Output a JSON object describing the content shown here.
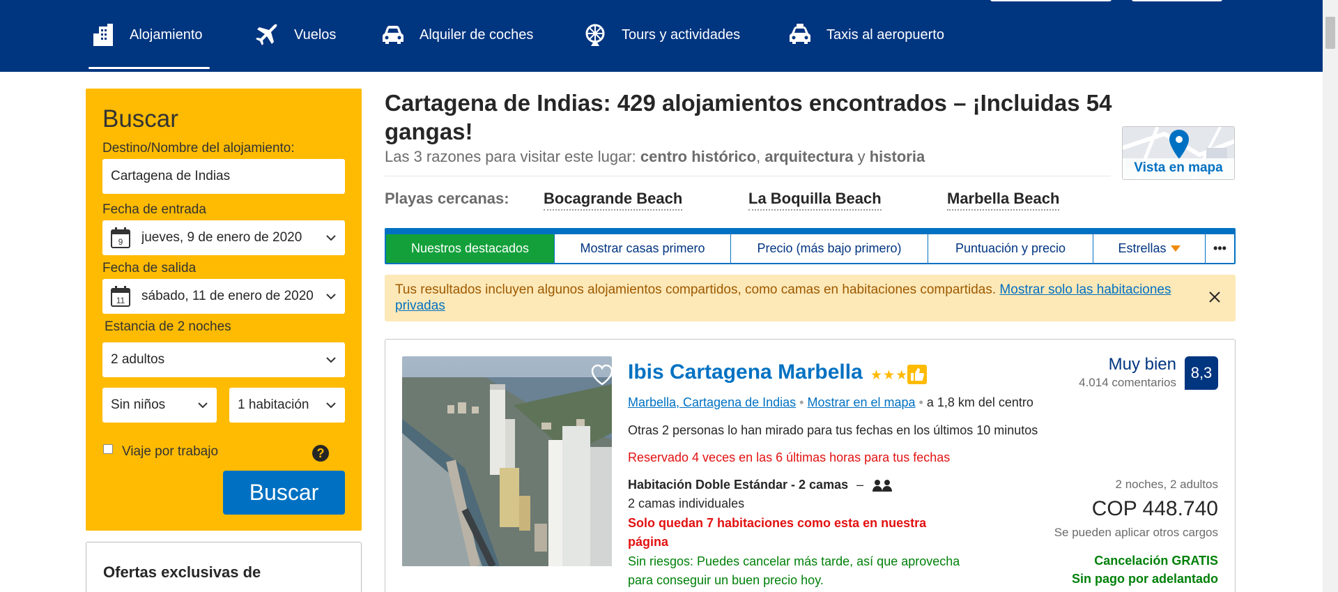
{
  "nav": {
    "items": [
      {
        "label": "Alojamiento",
        "icon": "building-icon",
        "active": true
      },
      {
        "label": "Vuelos",
        "icon": "plane-icon"
      },
      {
        "label": "Alquiler de coches",
        "icon": "car-icon"
      },
      {
        "label": "Tours y actividades",
        "icon": "ferris-wheel-icon"
      },
      {
        "label": "Taxis al aeropuerto",
        "icon": "taxi-icon"
      }
    ]
  },
  "search": {
    "title": "Buscar",
    "destination_label": "Destino/Nombre del alojamiento:",
    "destination_value": "Cartagena de Indias",
    "checkin_label": "Fecha de entrada",
    "checkin_value": "jueves, 9 de enero de 2020",
    "checkin_day": "9",
    "checkout_label": "Fecha de salida",
    "checkout_value": "sábado, 11 de enero de 2020",
    "checkout_day": "11",
    "stay_label": "Estancia de 2 noches",
    "adults_value": "2 adultos",
    "children_value": "Sin niños",
    "rooms_value": "1 habitación",
    "business_label": "Viaje por trabajo",
    "help_glyph": "?",
    "button_label": "Buscar",
    "offers_title": "Ofertas exclusivas de"
  },
  "results": {
    "title": "Cartagena de Indias: 429 alojamientos encontrados – ¡Incluidas 54 gangas!",
    "reasons_prefix": "Las 3 razones para visitar este lugar: ",
    "reason_1": "centro histórico",
    "sep_1": ", ",
    "reason_2": "arquitectura",
    "sep_2": " y ",
    "reason_3": "historia",
    "map_label": "Vista en mapa",
    "beaches_label": "Playas cercanas:",
    "beaches": [
      "Bocagrande Beach",
      "La Boquilla Beach",
      "Marbella Beach"
    ]
  },
  "sort": {
    "tabs": [
      "Nuestros destacados",
      "Mostrar casas primero",
      "Precio (más bajo primero)",
      "Puntuación y precio",
      "Estrellas"
    ],
    "more_glyph": "•••"
  },
  "notice": {
    "text": "Tus resultados incluyen algunos alojamientos compartidos, como camas en habitaciones compartidas. ",
    "link": "Mostrar solo las habitaciones privadas"
  },
  "property": {
    "name": "Ibis Cartagena Marbella",
    "stars_glyph": "★★★",
    "location": "Marbella, Cartagena de Indias",
    "map_link": "Mostrar en el mapa",
    "distance": "a 1,8 km del centro",
    "viewers": "Otras 2 personas lo han mirado para tus fechas en los últimos 10 minutos",
    "booked": "Reservado 4 veces en las 6 últimas horas para tus fechas",
    "room_type": "Habitación Doble Estándar - 2 camas",
    "room_dash": "–",
    "beds": "2 camas individuales",
    "urgency": "Solo quedan 7 habitaciones como esta en nuestra página",
    "no_risk": "Sin riesgos: Puedes cancelar más tarde, así que aprovecha para conseguir un buen precio hoy.",
    "rating_word": "Muy bien",
    "reviews": "4.014 comentarios",
    "score": "8,3",
    "stay_summary": "2 noches, 2 adultos",
    "price": "COP 448.740",
    "fees": "Se pueden aplicar otros cargos",
    "free_cancel": "Cancelación GRATIS",
    "no_prepay": "Sin pago por adelantado"
  },
  "colors": {
    "brand_blue": "#003580",
    "link_blue": "#0071c2",
    "search_yellow": "#febb02",
    "active_green": "#13a03a",
    "urgent_red": "#e21111",
    "ok_green": "#008009",
    "notice_bg": "#fde8b7"
  }
}
